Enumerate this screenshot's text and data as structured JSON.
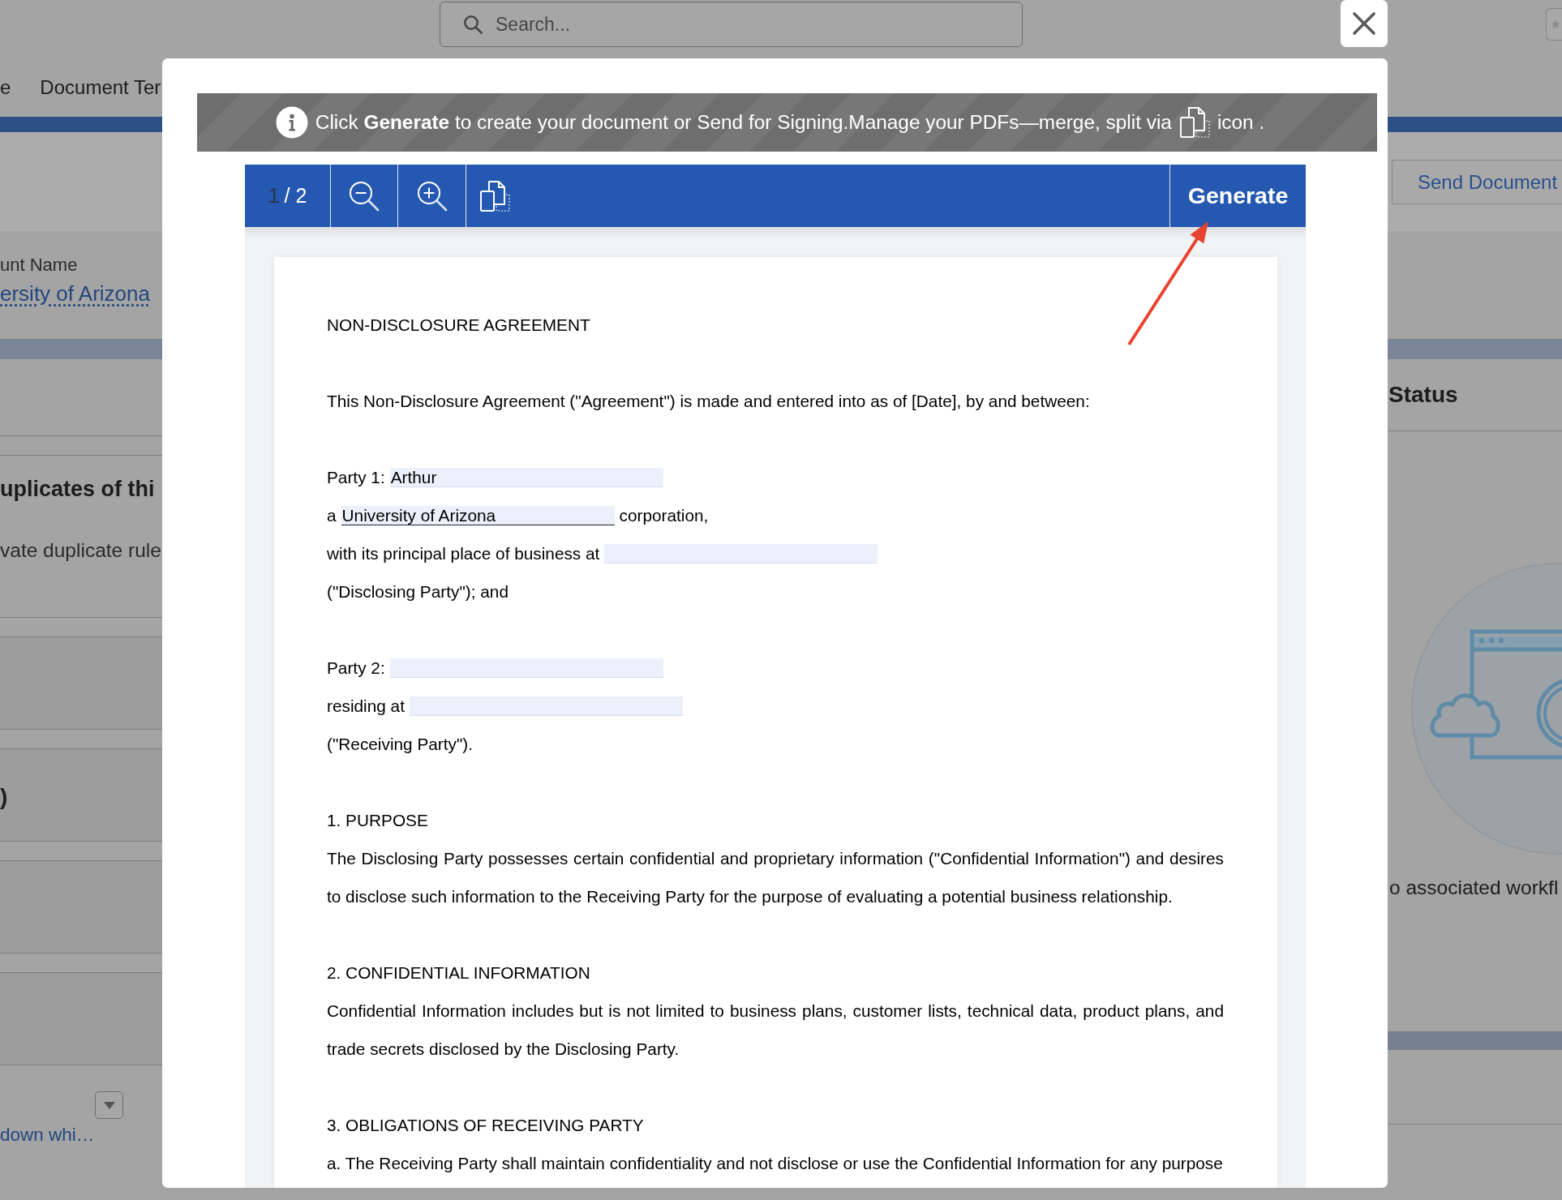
{
  "background_page": {
    "search": {
      "placeholder": "Search..."
    },
    "nav_labels": [
      "e",
      "Document Ter"
    ],
    "account_field": {
      "label": "unt Name",
      "value": "ersity of Arizona"
    },
    "send_button": "Send Document",
    "duplicates_card": {
      "title": "uplicates of thi",
      "text": "vate duplicate rule"
    },
    "list_fragment": ")",
    "dropdown_link": "down whi…",
    "status_card": {
      "title": "Status",
      "empty_text": "o associated workfl"
    }
  },
  "modal": {
    "banner": {
      "text": "Click **Generate** to create your document or Send for Signing.Manage your PDFs—merge, split via",
      "suffix": "icon ."
    },
    "toolbar": {
      "page_input": "1",
      "page_total": "/ 2",
      "generate_button": "Generate"
    },
    "document": {
      "title": "NON-DISCLOSURE AGREEMENT",
      "intro": "This Non-Disclosure Agreement (\"Agreement\") is made and entered into as of [Date], by and between:",
      "party_blocks": [
        {
          "lines": [
            {
              "parts": [
                {
                  "kind": "text",
                  "text": "Party 1:"
                },
                {
                  "kind": "field",
                  "value": "Arthur"
                }
              ]
            },
            {
              "parts": [
                {
                  "kind": "text",
                  "text": "a"
                },
                {
                  "kind": "underlined-field",
                  "value": "University of Arizona"
                },
                {
                  "kind": "text",
                  "text": "corporation,"
                }
              ]
            },
            {
              "parts": [
                {
                  "kind": "text",
                  "text": "with its principal place of business at"
                },
                {
                  "kind": "field"
                }
              ]
            },
            {
              "parts": [
                {
                  "kind": "text",
                  "text": "(\"Disclosing Party\"); and"
                }
              ]
            }
          ]
        },
        {
          "lines": [
            {
              "parts": [
                {
                  "kind": "text",
                  "text": "Party 2:"
                },
                {
                  "kind": "field"
                }
              ]
            },
            {
              "parts": [
                {
                  "kind": "text",
                  "text": "residing at"
                },
                {
                  "kind": "field"
                }
              ]
            },
            {
              "parts": [
                {
                  "kind": "text",
                  "text": "(\"Receiving Party\")."
                }
              ]
            }
          ]
        }
      ],
      "sections": [
        {
          "heading": "1. PURPOSE",
          "body": "The Disclosing Party possesses certain confidential and proprietary information (\"Confidential Information\") and desires to disclose such information to the Receiving Party for the purpose of evaluating a potential business relationship."
        },
        {
          "heading": "2. CONFIDENTIAL INFORMATION",
          "body": "Confidential Information includes but is not limited to business plans, customer lists, technical data, product plans, and trade secrets disclosed by the Disclosing Party."
        },
        {
          "heading": "3. OBLIGATIONS OF RECEIVING PARTY",
          "body": "a. The Receiving Party shall maintain confidentiality and not disclose or use the Confidential Information for any purpose"
        }
      ]
    }
  }
}
